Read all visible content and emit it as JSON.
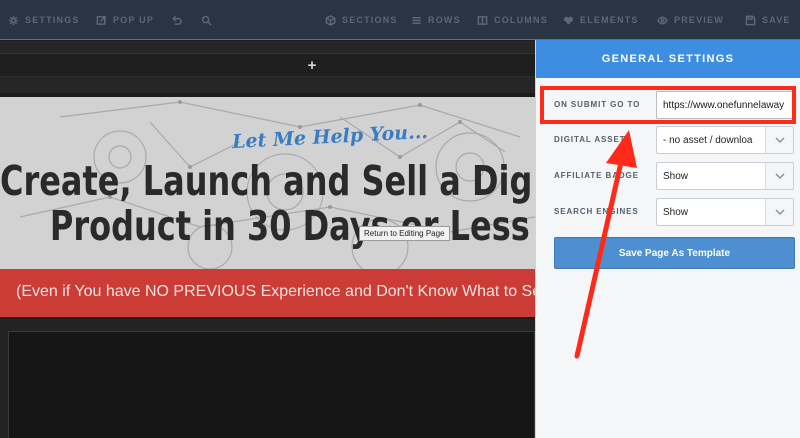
{
  "toolbar": {
    "settings": "SETTINGS",
    "popup": "POP UP",
    "sections": "SECTIONS",
    "rows": "ROWS",
    "columns": "COLUMNS",
    "elements": "ELEMENTS",
    "preview": "PREVIEW",
    "save": "SAVE"
  },
  "canvas": {
    "add_icon": "+",
    "tagline": "Let Me Help You...",
    "headline_line1": "Create, Launch and Sell a Digital",
    "headline_line2": "Product in 30 Days or Less",
    "tooltip": "Return to Editing Page",
    "subheadline": "(Even if You have NO PREVIOUS Experience and Don't Know What to Sell)"
  },
  "panel": {
    "title": "GENERAL SETTINGS",
    "fields": [
      {
        "label": "ON SUBMIT GO TO",
        "value": "https://www.onefunnelaway"
      },
      {
        "label": "DIGITAL ASSET",
        "value": "- no asset / downloa"
      },
      {
        "label": "AFFILIATE BADGE",
        "value": "Show"
      },
      {
        "label": "SEARCH ENGINES",
        "value": "Show"
      }
    ],
    "save_template": "Save Page As Template"
  },
  "colors": {
    "toolbar_bg": "#2a3544",
    "panel_header": "#3d8ee2",
    "button": "#4d8fd1",
    "red_band": "#cc3c36",
    "annotation": "#ff2a1a"
  },
  "icons": [
    "gear-icon",
    "popup-icon",
    "undo-icon",
    "search-icon",
    "cube-icon",
    "rows-icon",
    "columns-icon",
    "heart-icon",
    "eye-icon",
    "save-icon",
    "chevron-down-icon"
  ]
}
